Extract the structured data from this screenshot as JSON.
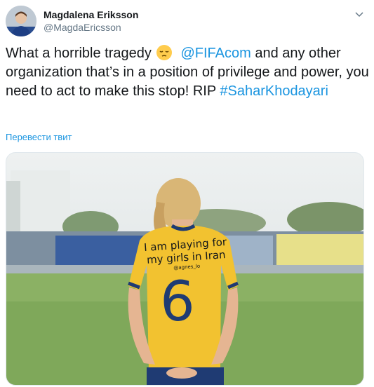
{
  "author": {
    "name": "Magdalena Eriksson",
    "handle": "@MagdaEricsson"
  },
  "tweet": {
    "text_part1": "What a horrible tragedy",
    "emoji": "pensive-face-emoji",
    "mention": "@FIFAcom",
    "text_part2": " and any other organization that’s in a position of privilege and power, you need to act to make this stop! RIP ",
    "hashtag": "#SaharKhodayari"
  },
  "translate_label": "Перевести твит",
  "photo": {
    "shirt_line1": "I am playing for",
    "shirt_line2": "my girls in Iran",
    "shirt_tag": "@agnes_lo",
    "shirt_number": "6",
    "shirt_color": "#f2c230",
    "number_color": "#1f3b73"
  },
  "colors": {
    "link": "#1b95e0",
    "secondary_text": "#657786"
  }
}
